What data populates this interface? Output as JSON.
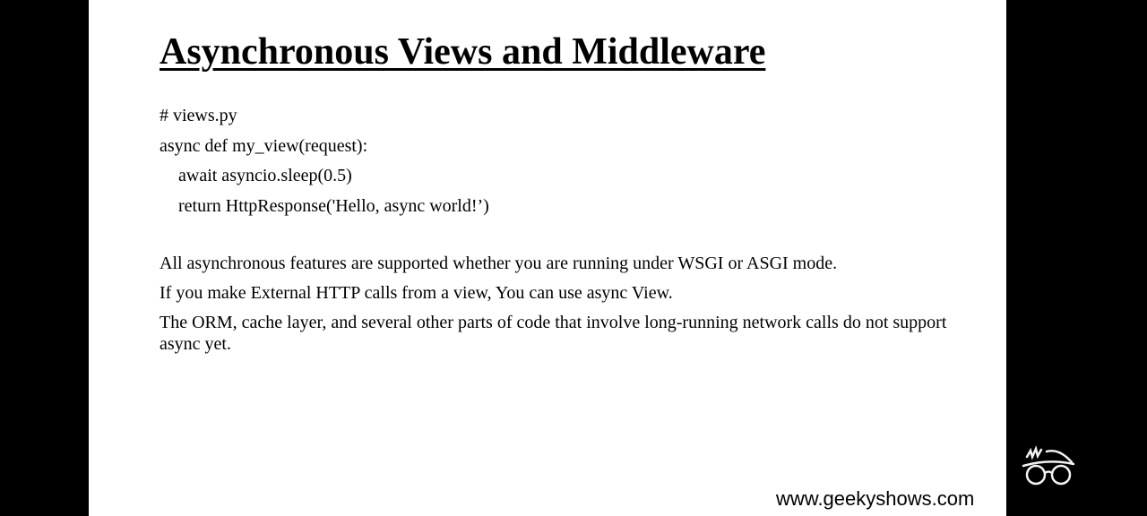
{
  "slide": {
    "title": "Asynchronous Views and Middleware",
    "code_lines": [
      "# views.py",
      "async def my_view(request):",
      "await asyncio.sleep(0.5)",
      "return HttpResponse('Hello, async world!’)"
    ],
    "paragraphs": [
      "All asynchronous features are supported whether you are running under WSGI or ASGI mode.",
      "If you make External HTTP calls from a view, You can use async View.",
      "The ORM, cache layer, and several other parts of code that involve long-running network calls do not support async yet."
    ]
  },
  "branding": {
    "website": "www.geekyshows.com",
    "logo_icon": "glasses-logo-icon"
  },
  "colors": {
    "background": "#000000",
    "slide": "#ffffff",
    "text": "#000000"
  }
}
